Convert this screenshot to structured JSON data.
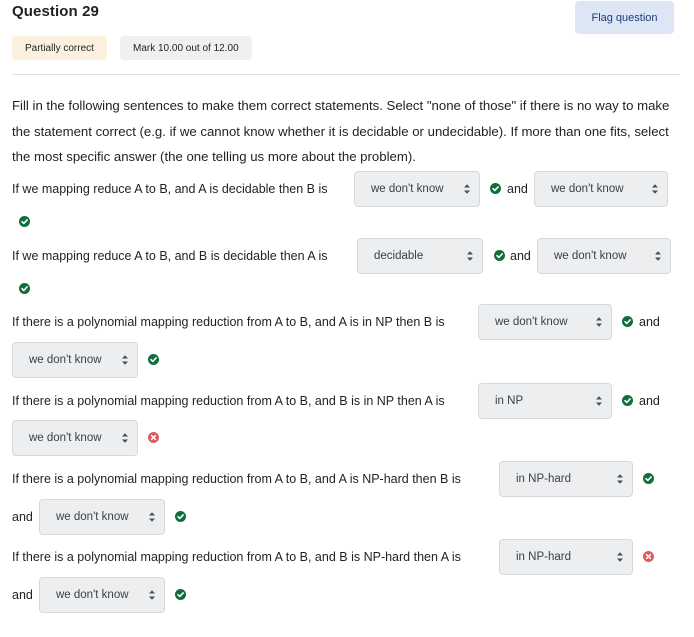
{
  "question": {
    "title": "Question 29",
    "flag_label": "Flag question",
    "state": "Partially correct",
    "mark": "Mark 10.00 out of 12.00",
    "prompt": "Fill in the following sentences to make them correct statements. Select \"none of those\" if there is no way to make the statement correct (e.g. if we cannot know whether it is decidable or undecidable). If more than one fits, select the most specific answer (the one telling us more about the problem)."
  },
  "connector": "and",
  "rows": [
    {
      "sentence": "If we mapping reduce A to B, and A is decidable then B is",
      "first_answer": "we don't know",
      "first_icon": "correct-icon",
      "second_answer": "we don't know",
      "second_icon": "correct-icon"
    },
    {
      "sentence": "If we mapping reduce A to B, and B is decidable then  A is",
      "first_answer": "decidable",
      "first_icon": "correct-icon",
      "second_answer": "we don't know",
      "second_icon": "correct-icon"
    },
    {
      "sentence": "If there is a polynomial mapping reduction from A to B, and A is in NP then B is",
      "first_answer": "we don't know",
      "first_icon": "correct-icon",
      "second_answer": "we don't know",
      "second_icon": "correct-icon"
    },
    {
      "sentence": "If there is a polynomial mapping reduction from A to B, and B is in NP then A is",
      "first_answer": "in NP",
      "first_icon": "correct-icon",
      "second_answer": "we don't know",
      "second_icon": "incorrect-icon"
    },
    {
      "sentence": "If there is a polynomial mapping reduction from A to B, and A is NP-hard then B is",
      "first_answer": "in NP-hard",
      "first_icon": "correct-icon",
      "second_answer": "we don't know",
      "second_icon": "correct-icon"
    },
    {
      "sentence": "If there is a polynomial mapping reduction from A to B, and B is NP-hard then A is",
      "first_answer": "in NP-hard",
      "first_icon": "incorrect-icon",
      "second_answer": "we don't know",
      "second_icon": "correct-icon"
    }
  ],
  "colors": {
    "correct": "#0f6e3c",
    "incorrect": "#e05b5b",
    "flag_bg": "#dde6f4",
    "partial_bg": "#fbf1de"
  }
}
